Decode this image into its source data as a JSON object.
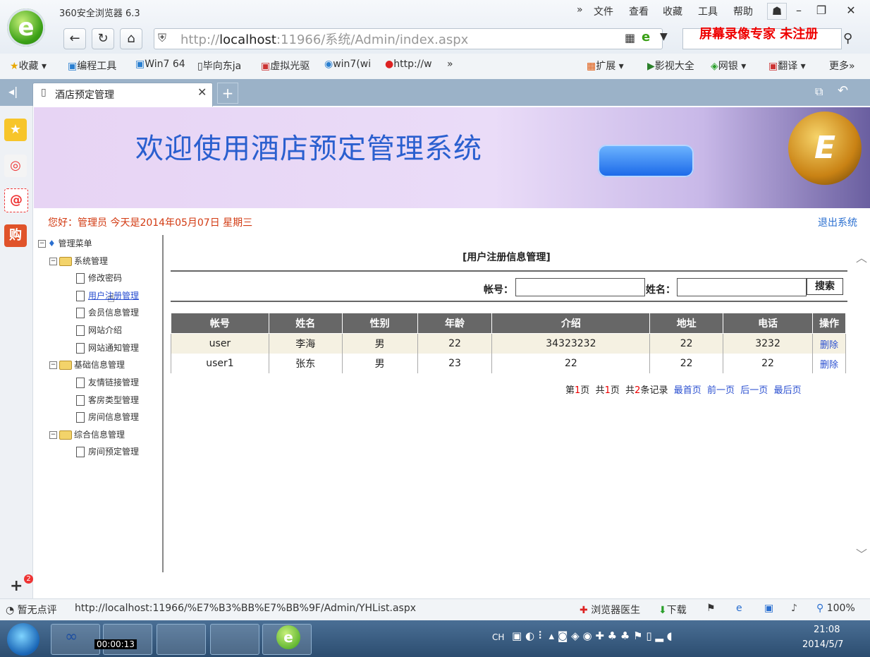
{
  "browser": {
    "app_title": "360安全浏览器 6.3",
    "menu": [
      "»",
      "文件",
      "查看",
      "收藏",
      "工具",
      "帮助"
    ],
    "address": "http://localhost:11966/系统/Admin/index.aspx",
    "address_host": "localhost",
    "address_prefix": "http://",
    "address_suffix": ":11966/系统/Admin/index.aspx",
    "watermark": "屏幕录像专家 未注册"
  },
  "favorites": {
    "items": [
      "收藏",
      "编程工具",
      "Win7 64",
      "毕向东ja",
      "虚拟光驱",
      "win7(wi",
      "http://w",
      "»"
    ],
    "right_items": [
      "扩展",
      "影视大全",
      "网银",
      "翻译",
      "更多»"
    ]
  },
  "tabs": [
    {
      "label": "酒店预定管理"
    }
  ],
  "banner": {
    "title": "欢迎使用酒店预定管理系统"
  },
  "header": {
    "greeting": "您好：管理员   今天是2014年05月07日   星期三",
    "logout": "退出系统"
  },
  "tree": {
    "root": "管理菜单",
    "groups": [
      {
        "label": "系统管理",
        "items": [
          "修改密码",
          "用户注册管理",
          "会员信息管理",
          "网站介绍",
          "网站通知管理"
        ]
      },
      {
        "label": "基础信息管理",
        "items": [
          "友情链接管理",
          "客房类型管理",
          "房间信息管理"
        ]
      },
      {
        "label": "综合信息管理",
        "items": [
          "房间预定管理"
        ]
      }
    ]
  },
  "panel": {
    "title": "[用户注册信息管理]",
    "account_label": "帐号：",
    "name_label": "姓名：",
    "account_value": "",
    "name_value": "",
    "search_label": "搜索"
  },
  "table": {
    "headers": [
      "帐号",
      "姓名",
      "性别",
      "年龄",
      "介绍",
      "地址",
      "电话",
      "操作"
    ],
    "rows": [
      [
        "user",
        "李海",
        "男",
        "22",
        "34323232",
        "22",
        "3232",
        "删除"
      ],
      [
        "user1",
        "张东",
        "男",
        "23",
        "22",
        "22",
        "22",
        "删除"
      ]
    ]
  },
  "pager": {
    "page_pre": "第",
    "page_num": "1",
    "page_post": "页",
    "total_pre": "共",
    "total_num": "1",
    "total_post": "页",
    "rec_pre": "共",
    "rec_num": "2",
    "rec_post": "条记录",
    "first": "最首页",
    "prev": "前一页",
    "next": "后一页",
    "last": "最后页"
  },
  "status": {
    "rating": "暂无点评",
    "url": "http://localhost:11966/%E7%B3%BB%E7%BB%9F/Admin/YHList.aspx",
    "doctor": "浏览器医生",
    "download": "下载",
    "zoom": "100%"
  },
  "taskbar": {
    "recording_time": "00:00:13",
    "tray_lang": "CH",
    "time": "21:08",
    "date": "2014/5/7"
  },
  "colors": {
    "accent": "#2a5fcf",
    "header_red": "#d23a12",
    "table_header": "#676767"
  }
}
